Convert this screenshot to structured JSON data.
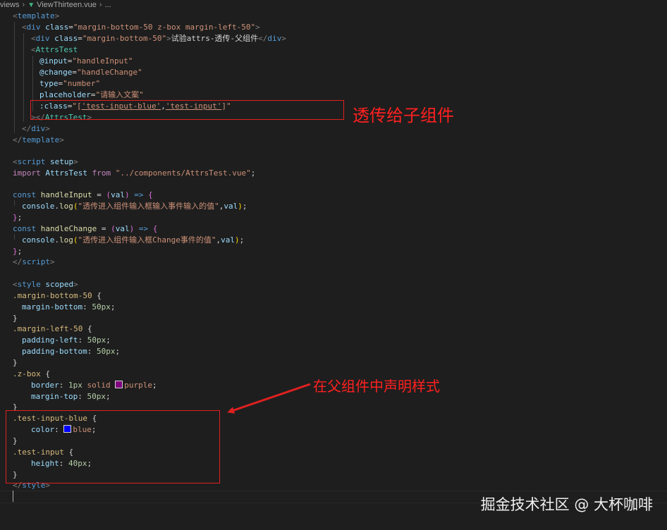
{
  "breadcrumb": {
    "folder": "views",
    "file": "ViewThirteen.vue",
    "tail": "..."
  },
  "code": {
    "l1_tag": "template",
    "l2_tag": "div",
    "l2_attr": "class",
    "l2_val": "\"margin-bottom-50 z-box margin-left-50\"",
    "l3_tag": "div",
    "l3_attr": "class",
    "l3_val": "\"margin-bottom-50\"",
    "l3_text": "试验attrs-透传-父组件",
    "l3_close": "div",
    "l4_comp": "AttrsTest",
    "l5_attr": "@input",
    "l5_val": "\"handleInput\"",
    "l6_attr": "@change",
    "l6_val": "\"handleChange\"",
    "l7_attr": "type",
    "l7_val": "\"number\"",
    "l8_attr": "placeholder",
    "l8_val": "\"请输入文案\"",
    "l9_attr": ":class",
    "l9_open": "\"[",
    "l9_s1": "'test-input-blue'",
    "l9_comma": ",",
    "l9_s2": "'test-input'",
    "l9_close": "]\"",
    "l10_comp": "AttrsTest",
    "l11_tag": "div",
    "l12_tag": "template",
    "l14_tag": "script",
    "l14_attr": "setup",
    "l15_kw": "import",
    "l15_name": "AttrsTest",
    "l15_from": "from",
    "l15_path": "\"../components/AttrsTest.vue\"",
    "l15_semi": ";",
    "l17_kw": "const",
    "l17_name": "handleInput",
    "l17_param": "val",
    "l18_obj": "console",
    "l18_fn": "log",
    "l18_str": "\"透传进入组件输入框输入事件输入的值\"",
    "l18_param": "val",
    "l20_kw": "const",
    "l20_name": "handleChange",
    "l20_param": "val",
    "l21_obj": "console",
    "l21_fn": "log",
    "l21_str": "\"透传进入组件输入框Change事件的值\"",
    "l21_param": "val",
    "l23_tag": "script",
    "l25_tag": "style",
    "l25_attr": "scoped",
    "l26_sel": ".margin-bottom-50",
    "l27_prop": "margin-bottom",
    "l27_val": "50px",
    "l29_sel": ".margin-left-50",
    "l30_prop": "padding-left",
    "l30_val": "50px",
    "l31_prop": "padding-bottom",
    "l31_val": "50px",
    "l33_sel": ".z-box",
    "l34_prop": "border",
    "l34_val1": "1px",
    "l34_val2": "solid",
    "l34_color": "purple",
    "l35_prop": "margin-top",
    "l35_val": "50px",
    "l37_sel": ".test-input-blue",
    "l38_prop": "color",
    "l38_color": "blue",
    "l40_sel": ".test-input",
    "l41_prop": "height",
    "l41_val": "40px",
    "l43_tag": "style"
  },
  "swatches": {
    "purple": "#800080",
    "blue": "#0000ff"
  },
  "annotations": {
    "passthrough": "透传给子组件",
    "declare": "在父组件中声明样式"
  },
  "watermark": "掘金技术社区 @ 大杯咖啡"
}
